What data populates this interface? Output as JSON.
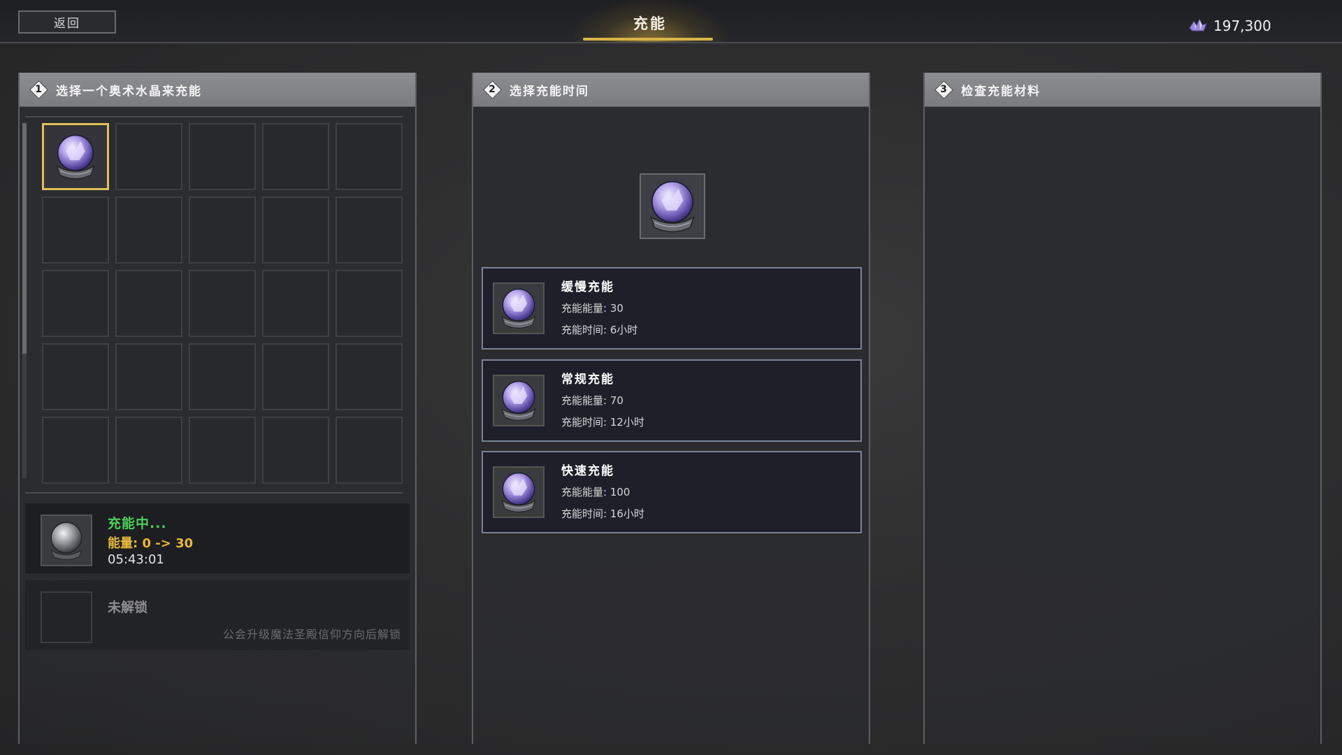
{
  "header": {
    "back_label": "返回",
    "title": "充能",
    "currency_icon": "crystal-shard-icon",
    "currency_value": "197,300"
  },
  "panel1": {
    "step": "1",
    "title": "选择一个奥术水晶来充能",
    "grid_rows": 5,
    "grid_cols": 5,
    "selected_slot_index": 0,
    "charging": {
      "status": "充能中...",
      "energy": "能量: 0 -> 30",
      "timer": "05:43:01"
    },
    "locked": {
      "title": "未解锁",
      "desc": "公会升级魔法圣殿信仰方向后解锁"
    }
  },
  "panel2": {
    "step": "2",
    "title": "选择充能时间",
    "options": [
      {
        "name": "缓慢充能",
        "energy": "充能能量: 30",
        "time": "充能时间: 6小时"
      },
      {
        "name": "常规充能",
        "energy": "充能能量: 70",
        "time": "充能时间: 12小时"
      },
      {
        "name": "快速充能",
        "energy": "充能能量: 100",
        "time": "充能时间: 16小时"
      }
    ]
  },
  "panel3": {
    "step": "3",
    "title": "检查充能材料"
  },
  "colors": {
    "accent_gold": "#d9b54a",
    "charging_green": "#4cd05a",
    "energy_orange": "#e7b83a"
  }
}
